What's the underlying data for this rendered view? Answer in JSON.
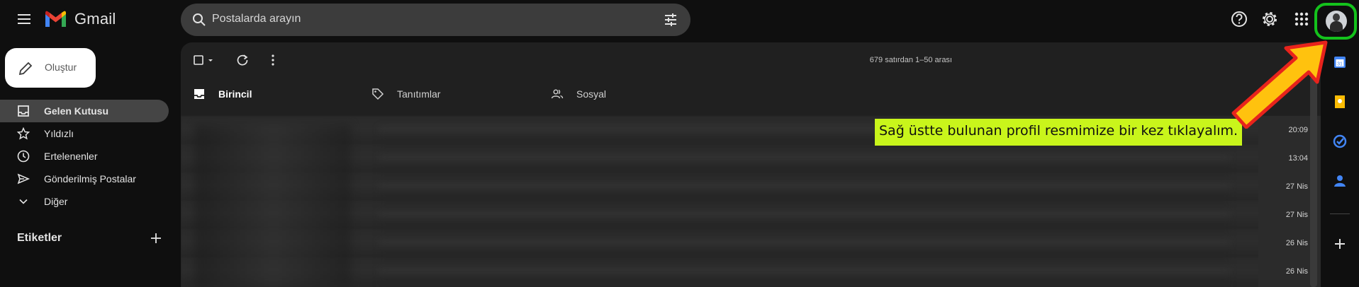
{
  "app": {
    "name": "Gmail"
  },
  "search": {
    "placeholder": "Postalarda arayın"
  },
  "compose": {
    "label": "Oluştur"
  },
  "sidebar": {
    "items": [
      {
        "label": "Gelen Kutusu",
        "icon": "inbox-icon",
        "active": true
      },
      {
        "label": "Yıldızlı",
        "icon": "star-icon",
        "active": false
      },
      {
        "label": "Ertelenenler",
        "icon": "clock-icon",
        "active": false
      },
      {
        "label": "Gönderilmiş Postalar",
        "icon": "send-icon",
        "active": false
      },
      {
        "label": "Diğer",
        "icon": "chevron-down-icon",
        "active": false
      }
    ],
    "labels_title": "Etiketler"
  },
  "toolbar": {
    "range_text": "679 satırdan 1–50 arası"
  },
  "tabs": [
    {
      "label": "Birincil",
      "icon": "inbox-icon",
      "active": true
    },
    {
      "label": "Tanıtımlar",
      "icon": "tag-icon",
      "active": false
    },
    {
      "label": "Sosyal",
      "icon": "people-icon",
      "active": false
    }
  ],
  "email_times": [
    "20:09",
    "13:04",
    "27 Nis",
    "27 Nis",
    "26 Nis",
    "26 Nis"
  ],
  "annotation": {
    "text": "Sağ üstte bulunan profil resmimize bir kez tıklayalım."
  },
  "colors": {
    "highlight": "#14c21c",
    "callout_bg": "#c9f51b",
    "arrow_fill": "#ffc20e",
    "arrow_stroke": "#e8231c"
  }
}
